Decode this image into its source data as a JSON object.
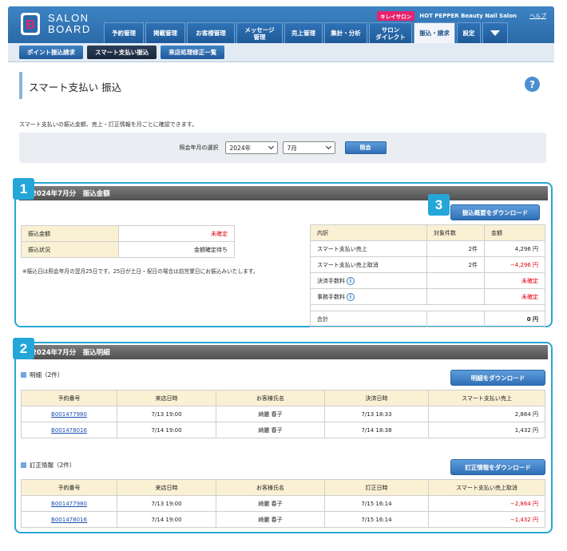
{
  "header": {
    "logo_line1": "SALON",
    "logo_line2": "BOARD",
    "badge": "キレイサロン",
    "store_name": "HOT PEPPER Beauty Nail Salon",
    "help": "ヘルプ",
    "nav": [
      {
        "label": "予約管理"
      },
      {
        "label": "掲載管理"
      },
      {
        "label": "お客様管理"
      },
      {
        "label": "メッセージ\n管理"
      },
      {
        "label": "売上管理"
      },
      {
        "label": "集計・分析"
      },
      {
        "label": "サロン\nダイレクト"
      },
      {
        "label": "振込・請求"
      },
      {
        "label": "設定"
      }
    ]
  },
  "subnav": [
    "ポイント振込請求",
    "スマート支払い振込",
    "来店処理修正一覧"
  ],
  "page": {
    "title": "スマート支払い 振込",
    "help_icon": "?",
    "description": "スマート支払いの振込金額、売上・訂正情報を月ごとに確認できます。"
  },
  "filter": {
    "label": "照会年月の選択",
    "year": "2024年",
    "month": "7月",
    "button": "照会"
  },
  "section1": {
    "badge": "1",
    "title": "2024年7月分　振込金額",
    "download_badge": "3",
    "download_button": "振込概要をダウンロード",
    "summary": [
      {
        "label": "振込金額",
        "value": "未確定"
      },
      {
        "label": "振込状況",
        "value": "金額確定待ち"
      }
    ],
    "note": "※振込日は照会年月の翌月25日です。25日が土日・祝日の場合は前営業日にお振込みいたします。",
    "breakdown_headers": [
      "内訳",
      "対象件数",
      "金額"
    ],
    "breakdown_rows": [
      {
        "label": "スマート支払い売上",
        "count": "2件",
        "amount": "4,296 円"
      },
      {
        "label": "スマート支払い売上取消",
        "count": "2件",
        "amount": "−4,296 円"
      },
      {
        "label": "決済手数料",
        "count": "",
        "amount": "未確定"
      },
      {
        "label": "事務手数料",
        "count": "",
        "amount": "未確定"
      }
    ],
    "total_label": "合計",
    "total_amount": "0 円",
    "info_icon": "i"
  },
  "section2": {
    "badge": "2",
    "title": "2024年7月分　振込明細",
    "details_heading": "明細（2件）",
    "details_button": "明細をダウンロード",
    "details_headers": [
      "予約番号",
      "来店日時",
      "お客様氏名",
      "決済日時",
      "スマート支払い売上"
    ],
    "details_rows": [
      [
        "B001477980",
        "7/13 19:00",
        "綺麗 春子",
        "7/13 18:33",
        "2,864 円"
      ],
      [
        "B001478016",
        "7/14 19:00",
        "綺麗 春子",
        "7/14 18:38",
        "1,432 円"
      ]
    ],
    "corrections_heading": "訂正情報（2件）",
    "corrections_button": "訂正情報をダウンロード",
    "corrections_headers": [
      "予約番号",
      "来店日時",
      "お客様氏名",
      "訂正日時",
      "スマート支払い売上取消"
    ],
    "corrections_rows": [
      [
        "B001477980",
        "7/13 19:00",
        "綺麗 春子",
        "7/15 16:14",
        "−2,864 円"
      ],
      [
        "B001478016",
        "7/14 19:00",
        "綺麗 春子",
        "7/15 16:14",
        "−1,432 円"
      ]
    ]
  },
  "colors": {
    "accent": "#2aa6d5",
    "nav": "#2a6aa8",
    "alert": "#e2000f"
  }
}
